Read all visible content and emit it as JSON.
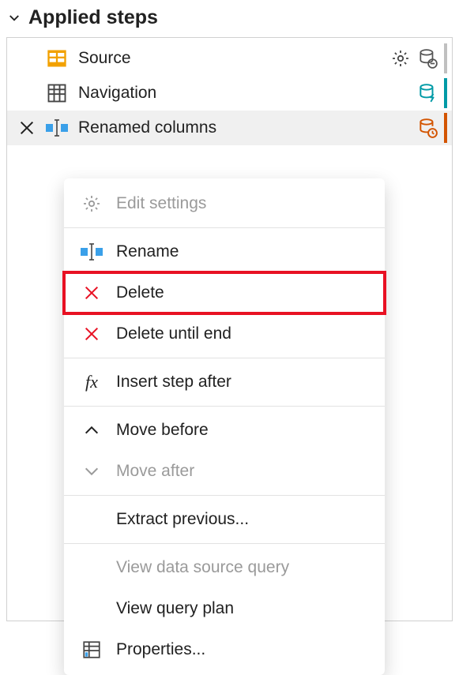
{
  "section": {
    "title": "Applied steps"
  },
  "steps": [
    {
      "label": "Source",
      "icon": "table-orange",
      "has_settings": true,
      "status": "db-remove",
      "marker": "gray"
    },
    {
      "label": "Navigation",
      "icon": "table-outline",
      "has_settings": false,
      "status": "db-bolt",
      "marker": "teal"
    },
    {
      "label": "Renamed columns",
      "icon": "rename-col",
      "has_settings": false,
      "status": "db-clock",
      "marker": "orange"
    }
  ],
  "context_menu": {
    "edit_settings": "Edit settings",
    "rename": "Rename",
    "delete": "Delete",
    "delete_until_end": "Delete until end",
    "insert_step_after": "Insert step after",
    "move_before": "Move before",
    "move_after": "Move after",
    "extract_previous": "Extract previous...",
    "view_data_source": "View data source query",
    "view_query_plan": "View query plan",
    "properties": "Properties..."
  }
}
